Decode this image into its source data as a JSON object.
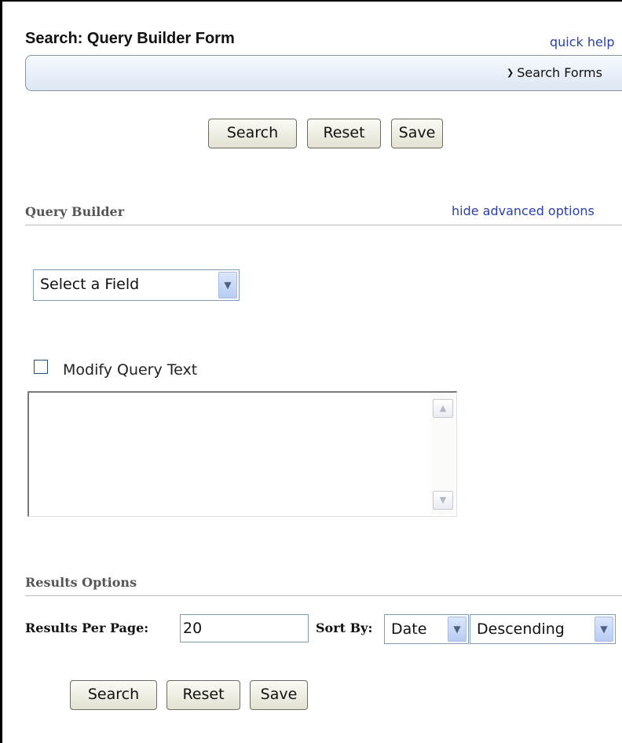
{
  "header": {
    "title": "Search: Query Builder Form",
    "quick_help": "quick help"
  },
  "search_forms_bar": {
    "label": "Search Forms",
    "chevron_icon": "chevron-down-icon"
  },
  "top_buttons": {
    "search": "Search",
    "reset": "Reset",
    "save": "Save"
  },
  "query_builder": {
    "heading": "Query Builder",
    "advanced_link": "hide advanced options",
    "field_select": {
      "selected": "Select a Field"
    },
    "modify_query": {
      "label": "Modify Query Text",
      "checked": false
    },
    "query_text": {
      "value": ""
    }
  },
  "results_options": {
    "heading": "Results Options",
    "results_per_page_label": "Results Per Page:",
    "results_per_page_value": "20",
    "sort_by_label": "Sort By:",
    "sort_field": "Date",
    "sort_order": "Descending"
  },
  "bottom_buttons": {
    "search": "Search",
    "reset": "Reset",
    "save": "Save"
  },
  "colors": {
    "link": "#2a3fa8",
    "input_border": "#7f9db9",
    "dropdown_button": "#b8ccf3"
  }
}
